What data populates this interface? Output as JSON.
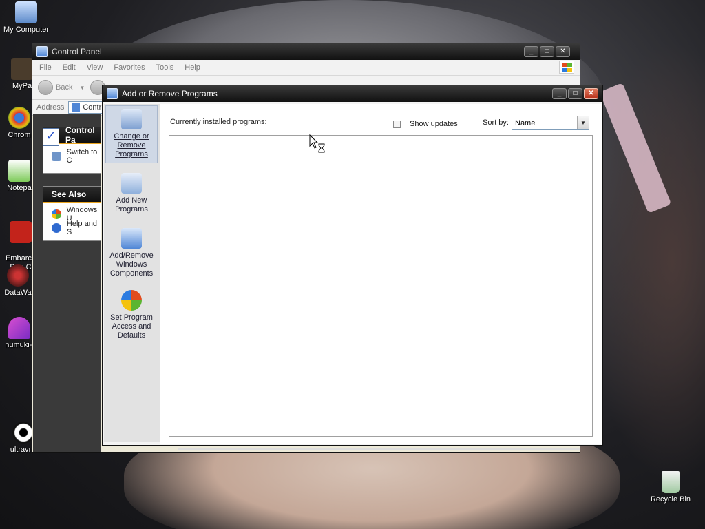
{
  "desktop": {
    "icons": [
      {
        "label": "My Computer"
      },
      {
        "label": "MyPa"
      },
      {
        "label": "Chrom"
      },
      {
        "label": "Notepa"
      },
      {
        "label": "Embarca\nDev-C"
      },
      {
        "label": "DataWa"
      },
      {
        "label": "numuki-l"
      },
      {
        "label": "ultravnc"
      },
      {
        "label": "Recycle Bin"
      }
    ]
  },
  "control_panel": {
    "title": "Control Panel",
    "menu": [
      "File",
      "Edit",
      "View",
      "Favorites",
      "Tools",
      "Help"
    ],
    "toolbar": {
      "back_label": "Back"
    },
    "address_label": "Address",
    "address_value": "Contr",
    "panel1": {
      "title": "Control Pa",
      "switch_label": "Switch to C"
    },
    "panel2": {
      "title": "See Also",
      "items": [
        "Windows U",
        "Help and S"
      ]
    }
  },
  "arp": {
    "title": "Add or Remove Programs",
    "sidebar": [
      {
        "label": "Change or Remove Programs"
      },
      {
        "label": "Add New Programs"
      },
      {
        "label": "Add/Remove Windows Components"
      },
      {
        "label": "Set Program Access and Defaults"
      }
    ],
    "installed_label": "Currently installed programs:",
    "show_updates_label": "Show updates",
    "sort_by_label": "Sort by:",
    "sort_value": "Name"
  }
}
